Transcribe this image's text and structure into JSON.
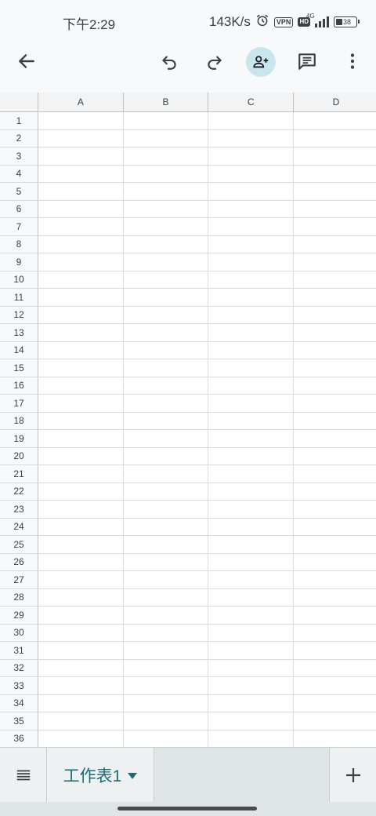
{
  "status_bar": {
    "time": "下午2:29",
    "net_speed": "143K/s",
    "vpn_label": "VPN",
    "hd_label": "HD",
    "network_type": "4G",
    "battery_level": "38"
  },
  "toolbar": {
    "back_icon": "arrow-left-icon",
    "undo_icon": "undo-icon",
    "redo_icon": "redo-icon",
    "share_icon": "person-add-icon",
    "comment_icon": "comment-icon",
    "more_icon": "more-vert-icon"
  },
  "spreadsheet": {
    "columns": [
      "A",
      "B",
      "C",
      "D"
    ],
    "rows": [
      "1",
      "2",
      "3",
      "4",
      "5",
      "6",
      "7",
      "8",
      "9",
      "10",
      "11",
      "12",
      "13",
      "14",
      "15",
      "16",
      "17",
      "18",
      "19",
      "20",
      "21",
      "22",
      "23",
      "24",
      "25",
      "26",
      "27",
      "28",
      "29",
      "30",
      "31",
      "32",
      "33",
      "34",
      "35",
      "36"
    ]
  },
  "sheet_tabs": {
    "menu_icon": "list-icon",
    "active_sheet": "工作表1",
    "add_icon": "plus-icon"
  },
  "colors": {
    "accent": "#1a6b74",
    "share_button_bg": "#c9e6ec",
    "header_bg": "#f1f3f4"
  }
}
